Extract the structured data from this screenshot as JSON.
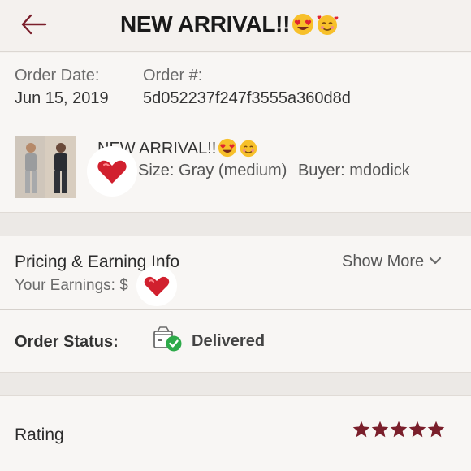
{
  "header": {
    "title": "NEW ARRIVAL!!",
    "title_emojis": [
      "heart-eyes-emoji",
      "smiling-face-with-hearts-emoji"
    ],
    "back_icon": "back-arrow-icon"
  },
  "order": {
    "date_label": "Order Date:",
    "date_value": "Jun 15, 2019",
    "number_label": "Order #:",
    "number_value": "5d052237f247f3555a360d8d"
  },
  "item": {
    "title": "NEW ARRIVAL!!",
    "size_text": "Size: Gray (medium)",
    "buyer_text": "Buyer: mdodick"
  },
  "pricing": {
    "heading": "Pricing & Earning Info",
    "earnings_label": "Your Earnings: $",
    "earnings_suffix": ")",
    "show_more": "Show More"
  },
  "status": {
    "label": "Order Status:",
    "value": "Delivered",
    "icon": "package-delivered-icon"
  },
  "rating": {
    "label": "Rating",
    "stars": 5,
    "max_stars": 5
  },
  "colors": {
    "accent": "#7a1f2b",
    "delivered_green": "#2eaa4a",
    "background": "#f4f1ee"
  }
}
